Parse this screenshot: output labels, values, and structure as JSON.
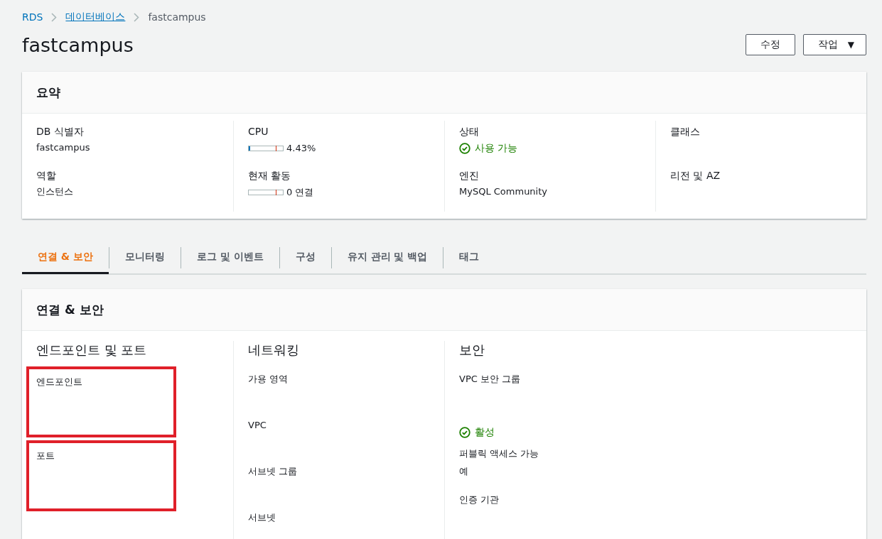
{
  "breadcrumbs": [
    {
      "text": "RDS",
      "kind": "link"
    },
    {
      "text": "데이터베이스",
      "kind": "underlined-link"
    },
    {
      "text": "fastcampus",
      "kind": "current"
    }
  ],
  "page_title": "fastcampus",
  "actions": [
    {
      "label": "수정",
      "kind": "button"
    },
    {
      "label": "작업",
      "kind": "dropdown",
      "caret": "▼"
    }
  ],
  "summary": {
    "title": "요약",
    "columns": [
      [
        {
          "label": "DB 식별자",
          "value": "fastcampus",
          "kind": "text"
        },
        {
          "label": "역할",
          "value": "인스턴스",
          "kind": "text"
        }
      ],
      [
        {
          "label": "CPU",
          "value": "4.43%",
          "kind": "meter",
          "level": 0.0443
        },
        {
          "label": "현재 활동",
          "value": "0 연결",
          "kind": "meter",
          "level": 0
        }
      ],
      [
        {
          "label": "상태",
          "value": "사용 가능",
          "kind": "status"
        },
        {
          "label": "엔진",
          "value": "MySQL Community",
          "kind": "text"
        }
      ],
      [
        {
          "label": "클래스"
        },
        {
          "label": "리전 및 AZ"
        }
      ]
    ]
  },
  "tabs": [
    {
      "label": "연결 & 보안",
      "selected": true
    },
    {
      "label": "모니터링",
      "selected": false
    },
    {
      "label": "로그 및 이벤트",
      "selected": false
    },
    {
      "label": "구성",
      "selected": false
    },
    {
      "label": "유지 관리 및 백업",
      "selected": false
    },
    {
      "label": "태그",
      "selected": false
    }
  ],
  "section": {
    "title": "연결 & 보안",
    "columns": [
      {
        "heading": "엔드포인트 및 포트",
        "items": [
          {
            "kind": "label",
            "text": "엔드포인트",
            "highlighted": true
          },
          {
            "kind": "label",
            "text": "포트",
            "highlighted": true
          }
        ]
      },
      {
        "heading": "네트워킹",
        "items": [
          {
            "kind": "label",
            "text": "가용 영역"
          },
          {
            "kind": "label",
            "text": "VPC"
          },
          {
            "kind": "label",
            "text": "서브넷 그룹"
          },
          {
            "kind": "label",
            "text": "서브넷"
          }
        ]
      },
      {
        "heading": "보안",
        "items": [
          {
            "kind": "label",
            "text": "VPC 보안 그룹"
          },
          {
            "kind": "status",
            "text": "활성"
          },
          {
            "kind": "label",
            "text": "퍼블릭 액세스 가능"
          },
          {
            "kind": "value",
            "text": "예"
          },
          {
            "kind": "label",
            "text": "인증 기관"
          }
        ]
      }
    ]
  }
}
